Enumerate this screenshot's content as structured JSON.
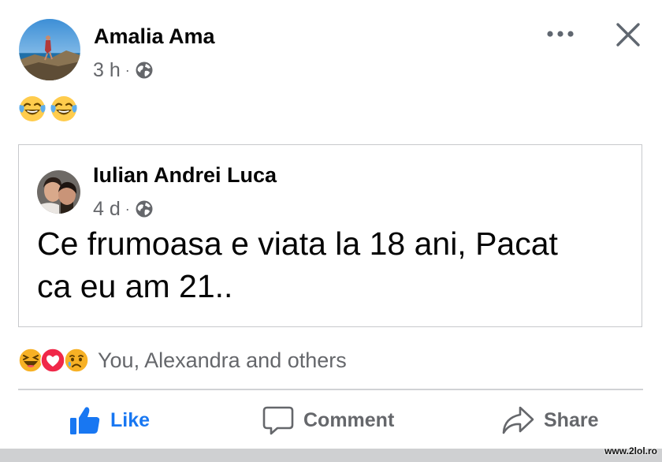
{
  "post": {
    "author": "Amalia Ama",
    "time": "3 h",
    "separator": "·",
    "audience_icon": "globe-icon",
    "text_emojis": [
      "face-with-tears-of-joy",
      "face-with-tears-of-joy"
    ]
  },
  "shared_post": {
    "author": "Iulian Andrei Luca",
    "time": "4 d",
    "separator": "·",
    "audience_icon": "globe-icon",
    "text_line1": "Ce frumoasa e viata la 18 ani, Pacat",
    "text_line2": "ca eu am 21.."
  },
  "reactions": {
    "icons": [
      "haha-reaction-icon",
      "love-reaction-icon",
      "sad-reaction-icon"
    ],
    "summary": "You, Alexandra and others"
  },
  "actions": {
    "like": "Like",
    "comment": "Comment",
    "share": "Share"
  },
  "header_icons": [
    "more-options-icon",
    "close-icon"
  ],
  "colors": {
    "like_blue": "#1877f2",
    "secondary_text": "#65676b",
    "border": "#c7c9cc"
  },
  "watermark": "www.2lol.ro"
}
